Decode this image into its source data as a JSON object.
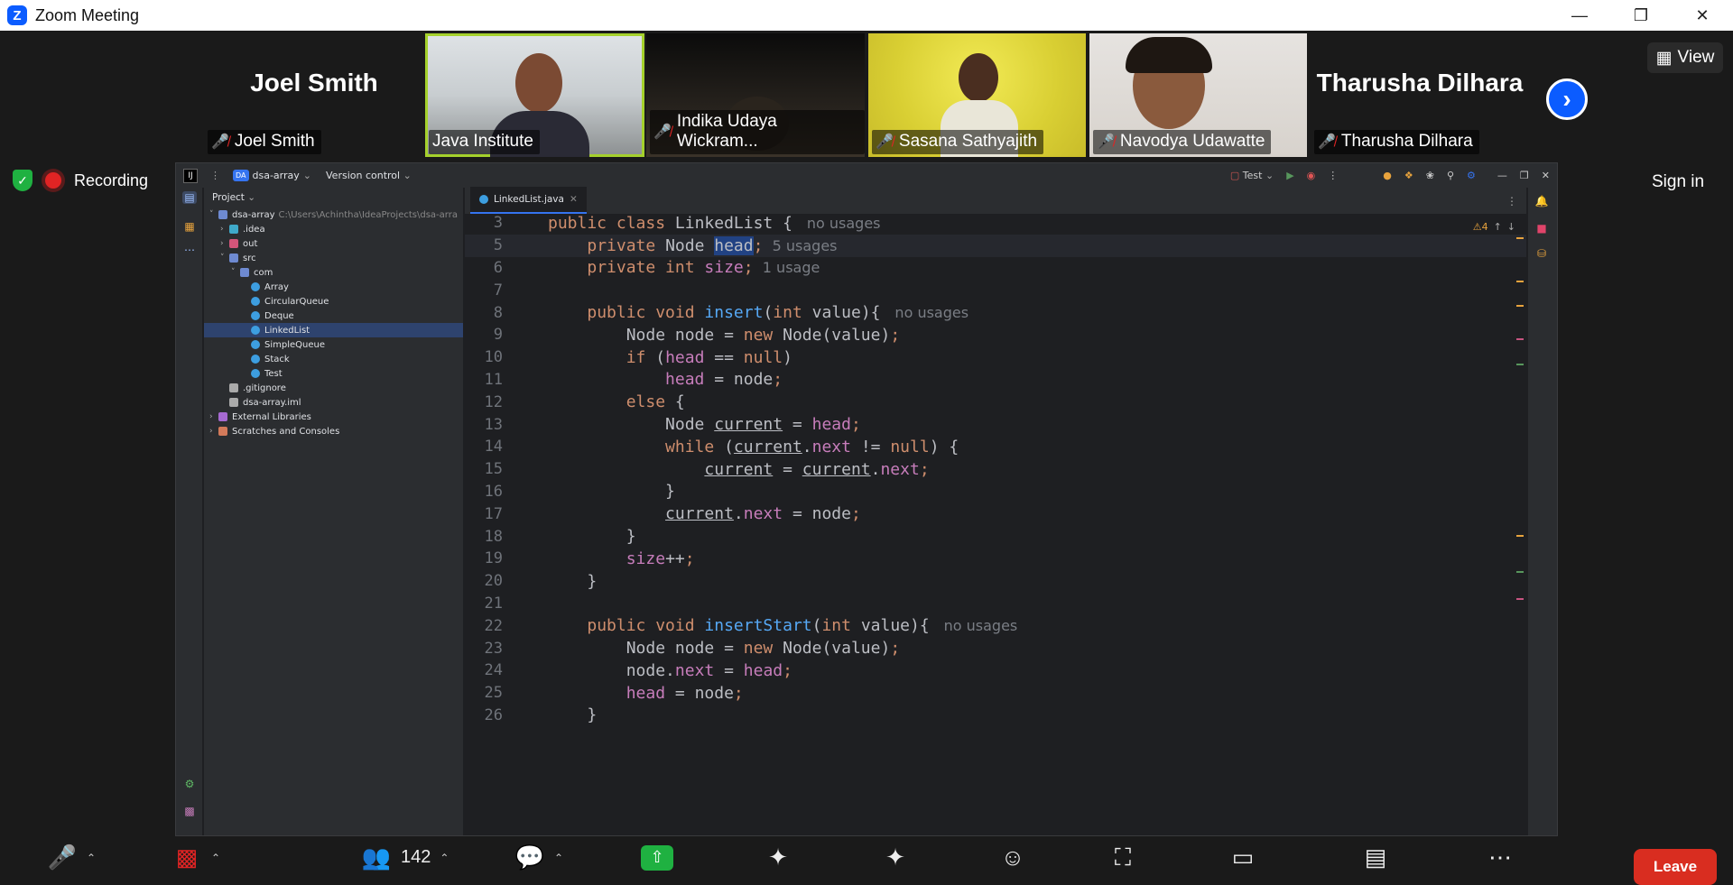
{
  "window": {
    "title": "Zoom Meeting",
    "logo": "Z",
    "min_icon": "minimize-icon",
    "max_icon": "restore-icon",
    "close_icon": "close-icon"
  },
  "participants": [
    {
      "name": "Joel Smith",
      "big_name": "Joel Smith",
      "muted": true,
      "video": false
    },
    {
      "name": "Java Institute",
      "muted": false,
      "video": true,
      "active": true
    },
    {
      "name": "Indika Udaya Wickram...",
      "muted": true,
      "video": true
    },
    {
      "name": "Sasana Sathyajith",
      "muted": true,
      "video": true
    },
    {
      "name": "Navodya Udawatte",
      "muted": true,
      "video": true
    },
    {
      "name": "Tharusha Dilhara",
      "big_name": "Tharusha Dilhara",
      "muted": true,
      "video": false
    }
  ],
  "view_label": "View",
  "recording_label": "Recording",
  "sign_in_label": "Sign in",
  "ide": {
    "project_name": "dsa-array",
    "project_badge": "DA",
    "version_control": "Version control",
    "run_config": "Test",
    "panel_title": "Project",
    "tree": [
      {
        "label": "dsa-array",
        "path": "C:\\Users\\Achintha\\IdeaProjects\\dsa-arra",
        "level": 0,
        "open": true,
        "type": "module"
      },
      {
        "label": ".idea",
        "level": 1,
        "open": false,
        "type": "folder"
      },
      {
        "label": "out",
        "level": 1,
        "open": false,
        "type": "folder-excluded"
      },
      {
        "label": "src",
        "level": 1,
        "open": true,
        "type": "folder-src"
      },
      {
        "label": "com",
        "level": 2,
        "open": true,
        "type": "package"
      },
      {
        "label": "Array",
        "level": 3,
        "type": "class"
      },
      {
        "label": "CircularQueue",
        "level": 3,
        "type": "class"
      },
      {
        "label": "Deque",
        "level": 3,
        "type": "class"
      },
      {
        "label": "LinkedList",
        "level": 3,
        "type": "class",
        "selected": true
      },
      {
        "label": "SimpleQueue",
        "level": 3,
        "type": "class"
      },
      {
        "label": "Stack",
        "level": 3,
        "type": "class"
      },
      {
        "label": "Test",
        "level": 3,
        "type": "class"
      },
      {
        "label": ".gitignore",
        "level": 1,
        "type": "file"
      },
      {
        "label": "dsa-array.iml",
        "level": 1,
        "type": "file"
      },
      {
        "label": "External Libraries",
        "level": 0,
        "open": false,
        "type": "lib"
      },
      {
        "label": "Scratches and Consoles",
        "level": 0,
        "open": false,
        "type": "scratch"
      }
    ],
    "tab_name": "LinkedList.java",
    "warnings": "4",
    "code": [
      {
        "n": "3",
        "t": [
          [
            "kw",
            "public class "
          ],
          [
            "",
            "LinkedList { "
          ],
          [
            "hint",
            " no usages"
          ]
        ]
      },
      {
        "n": "5",
        "cur": true,
        "t": [
          [
            "",
            "    "
          ],
          [
            "kw",
            "private "
          ],
          [
            "",
            "Node "
          ],
          [
            "hl",
            "head"
          ],
          [
            "kw",
            ";"
          ],
          [
            "hint",
            "  5 usages"
          ]
        ]
      },
      {
        "n": "6",
        "t": [
          [
            "",
            "    "
          ],
          [
            "kw",
            "private int "
          ],
          [
            "fl",
            "size"
          ],
          [
            "kw",
            ";"
          ],
          [
            "hint",
            "  1 usage"
          ]
        ]
      },
      {
        "n": "7",
        "t": []
      },
      {
        "n": "8",
        "t": [
          [
            "",
            "    "
          ],
          [
            "kw",
            "public void "
          ],
          [
            "fn",
            "insert"
          ],
          [
            "",
            "("
          ],
          [
            "kw",
            "int "
          ],
          [
            "",
            "value){ "
          ],
          [
            "hint",
            " no usages"
          ]
        ]
      },
      {
        "n": "9",
        "t": [
          [
            "",
            "        Node node = "
          ],
          [
            "kw",
            "new "
          ],
          [
            "",
            "Node(value)"
          ],
          [
            "kw",
            ";"
          ]
        ]
      },
      {
        "n": "10",
        "t": [
          [
            "",
            "        "
          ],
          [
            "kw",
            "if "
          ],
          [
            "",
            "("
          ],
          [
            "fl",
            "head"
          ],
          [
            "",
            " == "
          ],
          [
            "kw",
            "null"
          ],
          [
            "",
            ")"
          ]
        ]
      },
      {
        "n": "11",
        "t": [
          [
            "",
            "            "
          ],
          [
            "fl",
            "head"
          ],
          [
            "",
            " = node"
          ],
          [
            "kw",
            ";"
          ]
        ]
      },
      {
        "n": "12",
        "t": [
          [
            "",
            "        "
          ],
          [
            "kw",
            "else "
          ],
          [
            "",
            "{"
          ]
        ]
      },
      {
        "n": "13",
        "t": [
          [
            "",
            "            Node "
          ],
          [
            "var",
            "current"
          ],
          [
            "",
            " = "
          ],
          [
            "fl",
            "head"
          ],
          [
            "kw",
            ";"
          ]
        ]
      },
      {
        "n": "14",
        "t": [
          [
            "",
            "            "
          ],
          [
            "kw",
            "while "
          ],
          [
            "",
            "("
          ],
          [
            "var",
            "current"
          ],
          [
            "",
            "."
          ],
          [
            "fl",
            "next"
          ],
          [
            "",
            " != "
          ],
          [
            "kw",
            "null"
          ],
          [
            "",
            ") {"
          ]
        ]
      },
      {
        "n": "15",
        "t": [
          [
            "",
            "                "
          ],
          [
            "var",
            "current"
          ],
          [
            "",
            " = "
          ],
          [
            "var",
            "current"
          ],
          [
            "",
            "."
          ],
          [
            "fl",
            "next"
          ],
          [
            "kw",
            ";"
          ]
        ]
      },
      {
        "n": "16",
        "t": [
          [
            "",
            "            }"
          ]
        ]
      },
      {
        "n": "17",
        "t": [
          [
            "",
            "            "
          ],
          [
            "var",
            "current"
          ],
          [
            "",
            "."
          ],
          [
            "fl",
            "next"
          ],
          [
            "",
            " = node"
          ],
          [
            "kw",
            ";"
          ]
        ]
      },
      {
        "n": "18",
        "t": [
          [
            "",
            "        }"
          ]
        ]
      },
      {
        "n": "19",
        "t": [
          [
            "",
            "        "
          ],
          [
            "fl",
            "size"
          ],
          [
            "",
            "++"
          ],
          [
            "kw",
            ";"
          ]
        ]
      },
      {
        "n": "20",
        "t": [
          [
            "",
            "    }"
          ]
        ]
      },
      {
        "n": "21",
        "t": []
      },
      {
        "n": "22",
        "t": [
          [
            "",
            "    "
          ],
          [
            "kw",
            "public void "
          ],
          [
            "fn",
            "insertStart"
          ],
          [
            "",
            "("
          ],
          [
            "kw",
            "int "
          ],
          [
            "",
            "value){ "
          ],
          [
            "hint",
            " no usages"
          ]
        ]
      },
      {
        "n": "23",
        "t": [
          [
            "",
            "        Node node = "
          ],
          [
            "kw",
            "new "
          ],
          [
            "",
            "Node(value)"
          ],
          [
            "kw",
            ";"
          ]
        ]
      },
      {
        "n": "24",
        "t": [
          [
            "",
            "        node."
          ],
          [
            "fl",
            "next"
          ],
          [
            "",
            " = "
          ],
          [
            "fl",
            "head"
          ],
          [
            "kw",
            ";"
          ]
        ]
      },
      {
        "n": "25",
        "t": [
          [
            "",
            "        "
          ],
          [
            "fl",
            "head"
          ],
          [
            "",
            " = node"
          ],
          [
            "kw",
            ";"
          ]
        ]
      },
      {
        "n": "26",
        "t": [
          [
            "",
            "    }"
          ]
        ]
      }
    ]
  },
  "toolbar": {
    "participants_count": "142",
    "leave_label": "Leave",
    "icons": [
      "mute-mic-icon",
      "stop-video-icon",
      "participants-icon",
      "chat-icon",
      "share-screen-icon",
      "summary-icon",
      "ai-companion-icon",
      "reactions-icon",
      "apps-icon",
      "whiteboard-icon",
      "notes-icon",
      "more-icon"
    ]
  },
  "colors": {
    "zoom_blue": "#0b5cff",
    "share_green": "#1fb141",
    "leave_red": "#d92d20",
    "active_speaker": "#a5d12c"
  }
}
